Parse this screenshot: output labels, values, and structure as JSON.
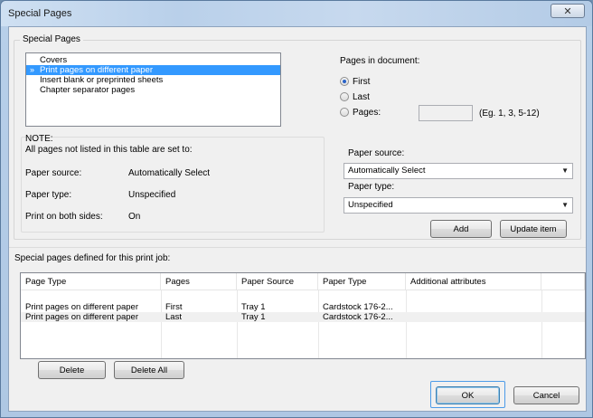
{
  "window": {
    "title": "Special Pages",
    "close_glyph": "✕"
  },
  "special_pages": {
    "group_label": "Special Pages",
    "list_items": [
      {
        "label": "Covers",
        "selected": false,
        "marker": ""
      },
      {
        "label": "Print pages on different paper",
        "selected": true,
        "marker": "»"
      },
      {
        "label": "Insert blank or preprinted sheets",
        "selected": false,
        "marker": ""
      },
      {
        "label": "Chapter separator pages",
        "selected": false,
        "marker": ""
      }
    ],
    "pages_in_document": {
      "label": "Pages in document:",
      "options": [
        {
          "label": "First",
          "checked": true
        },
        {
          "label": "Last",
          "checked": false
        },
        {
          "label": "Pages:",
          "checked": false
        }
      ],
      "pages_value": "",
      "pages_hint": "(Eg. 1, 3, 5-12)"
    },
    "note": {
      "title": "NOTE:",
      "subtitle": "All pages not listed in this table are set to:",
      "rows": [
        {
          "label": "Paper source:",
          "value": "Automatically Select"
        },
        {
          "label": "Paper type:",
          "value": "Unspecified"
        },
        {
          "label": "Print on both sides:",
          "value": "On"
        }
      ]
    },
    "paper_source": {
      "label": "Paper source:",
      "value": "Automatically Select"
    },
    "paper_type": {
      "label": "Paper type:",
      "value": "Unspecified"
    },
    "add_label": "Add",
    "update_label": "Update item"
  },
  "defined": {
    "label": "Special pages defined for this print job:",
    "columns": [
      "Page Type",
      "Pages",
      "Paper Source",
      "Paper Type",
      "Additional attributes"
    ],
    "rows": [
      [
        "Print pages on different paper",
        "First",
        "Tray 1",
        "Cardstock 176-2...",
        ""
      ],
      [
        "Print pages on different paper",
        "Last",
        "Tray 1",
        "Cardstock 176-2...",
        ""
      ]
    ],
    "delete_label": "Delete",
    "delete_all_label": "Delete All"
  },
  "footer": {
    "ok_label": "OK",
    "cancel_label": "Cancel"
  }
}
